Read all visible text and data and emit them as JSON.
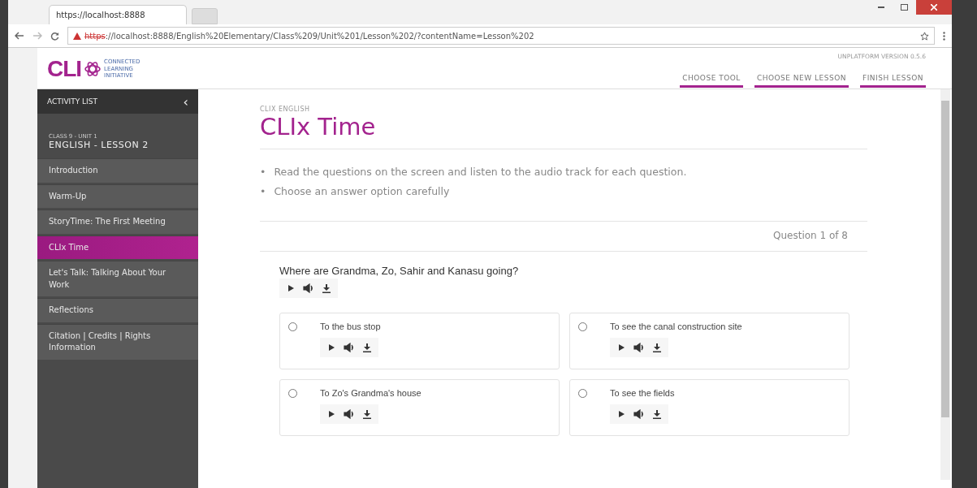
{
  "browser": {
    "tab_title": "https://localhost:8888",
    "url_scheme": "https",
    "url_rest": "://localhost:8888/English%20Elementary/Class%209/Unit%201/Lesson%202/?contentName=Lesson%202"
  },
  "header": {
    "logo": "CLI",
    "logo_tagline": "CONNECTED LEARNING INITIATIVE",
    "version": "UNPLATFORM VERSION 0.5.6",
    "nav": [
      "CHOOSE TOOL",
      "CHOOSE NEW LESSON",
      "FINISH LESSON"
    ]
  },
  "sidebar": {
    "title": "ACTIVITY LIST",
    "collapse": "‹",
    "unit": "CLASS 9 - UNIT 1",
    "lesson": "ENGLISH - LESSON 2",
    "items": [
      {
        "label": "Introduction",
        "selected": false
      },
      {
        "label": "Warm-Up",
        "selected": false
      },
      {
        "label": "StoryTime: The First Meeting",
        "selected": false
      },
      {
        "label": "CLIx Time",
        "selected": true
      },
      {
        "label": "Let's Talk: Talking About Your Work",
        "selected": false
      },
      {
        "label": "Reflections",
        "selected": false
      },
      {
        "label": "Citation | Credits | Rights Information",
        "selected": false
      }
    ]
  },
  "content": {
    "eyebrow": "CLIX ENGLISH",
    "title": "CLIx Time",
    "bullet": "•",
    "instructions": [
      "Read the questions on the screen and listen to the audio track for each question.",
      "Choose an answer option carefully"
    ],
    "progress": "Question 1 of 8",
    "question": "Where are Grandma, Zo, Sahir and Kanasu going?",
    "options": [
      {
        "label": "To the bus stop",
        "selected": false
      },
      {
        "label": "To see the canal construction site",
        "selected": false
      },
      {
        "label": "To Zo's Grandma's house",
        "selected": false
      },
      {
        "label": "To see the fields",
        "selected": false
      }
    ]
  }
}
